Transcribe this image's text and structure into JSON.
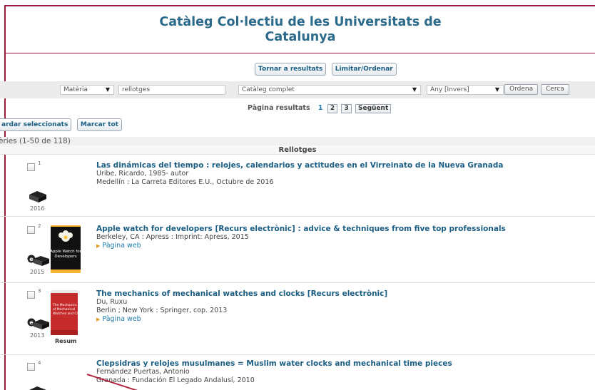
{
  "header": {
    "title_line1": "Catàleg Col·lectiu de les Universitats de",
    "title_line2": "Catalunya"
  },
  "top_actions": {
    "back": "Tornar a resultats",
    "limit": "Limitar/Ordenar"
  },
  "search": {
    "field": "Matèria",
    "query": "rellotges",
    "catalog": "Catàleg complet",
    "sort": "Any [Invers]",
    "sort_button": "Ordena",
    "search_button": "Cerca"
  },
  "pager": {
    "label": "Pàgina resultats",
    "current": "1",
    "pages": [
      "2",
      "3"
    ],
    "next": "Següent"
  },
  "selection": {
    "save": "ardar seleccionats",
    "mark_all": "Marcar tot"
  },
  "results": {
    "count_text": "èries (1-50 de 118)",
    "subject": "Rellotges"
  },
  "records": [
    {
      "num": "1",
      "title": "Las dinámicas del tiempo : relojes, calendarios y actitudes en el Virreinato de la Nueva Granada",
      "author": "Uribe, Ricardo, 1985- autor",
      "imprint": "Medellín : La Carreta Editores E.U., Octubre de 2016",
      "year": "2016"
    },
    {
      "num": "2",
      "title": "Apple watch for developers [Recurs electrònic] : advice & techniques from five top professionals",
      "author": "Berkeley, CA : Apress : Imprint: Apress, 2015",
      "link": "Pàgina web",
      "year": "2015",
      "cover_title": "Apple Watch for Developers"
    },
    {
      "num": "3",
      "title": "The mechanics of mechanical watches and clocks [Recurs electrònic]",
      "author": "Du, Ruxu",
      "imprint": "Berlin ; New York : Springer, cop. 2013",
      "link": "Pàgina web",
      "year": "2013",
      "cover_title": "The Mechanics of Mechanical Watches and Clocks",
      "resum": "Resum"
    },
    {
      "num": "4",
      "title": "Clepsidras y relojes musulmanes = Muslim water clocks and mechanical time pieces",
      "author": "Fernández Puertas, Antonio",
      "imprint": "Granada : Fundación El Legado Andalusí, 2010"
    }
  ],
  "colors": {
    "title": "#2b6a8a",
    "link": "#1b5e84",
    "accent_border": "#9b1c3b"
  }
}
